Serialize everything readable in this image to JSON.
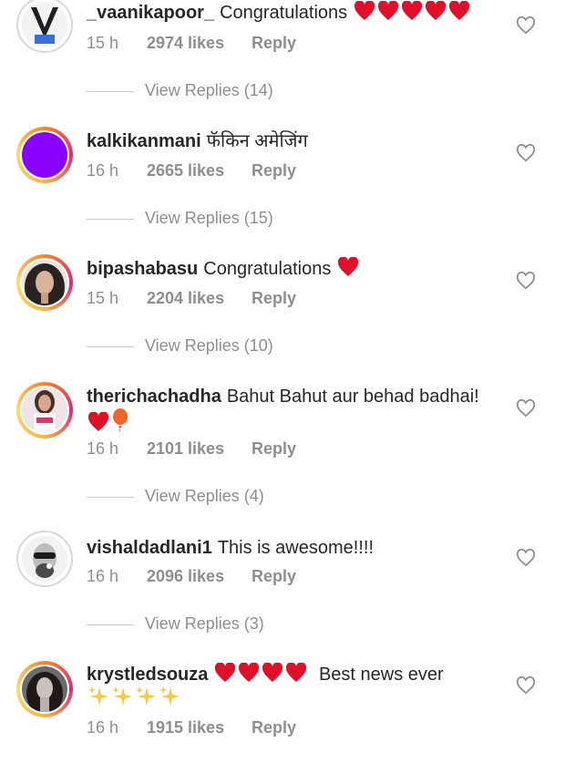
{
  "comments": [
    {
      "username": "_vaanikapoor_",
      "text": "Congratulations",
      "emoji": [
        "red-heart",
        "red-heart",
        "red-heart",
        "red-heart",
        "red-heart"
      ],
      "time": "15 h",
      "likes": "2974 likes",
      "reply": "Reply",
      "view_replies": "View Replies (14)"
    },
    {
      "username": "kalkikanmani",
      "text": "फॅकिन अमेजिंग",
      "time": "16 h",
      "likes": "2665 likes",
      "reply": "Reply",
      "view_replies": "View Replies (15)"
    },
    {
      "username": "bipashabasu",
      "text": "Congratulations",
      "emoji": [
        "red-heart"
      ],
      "time": "15 h",
      "likes": "2204 likes",
      "reply": "Reply",
      "view_replies": "View Replies (10)"
    },
    {
      "username": "therichachadha",
      "text": "Bahut Bahut aur behad badhai!",
      "emoji": [
        "red-heart",
        "balloon"
      ],
      "time": "16 h",
      "likes": "2101 likes",
      "reply": "Reply",
      "view_replies": "View Replies (4)"
    },
    {
      "username": "vishaldadlani1",
      "text": "This is awesome!!!!",
      "time": "16 h",
      "likes": "2096 likes",
      "reply": "Reply",
      "view_replies": "View Replies (3)"
    },
    {
      "username": "krystledsouza",
      "text": "Best news ever",
      "emoji": [
        "red-heart",
        "red-heart",
        "red-heart",
        "red-heart",
        "sparkles",
        "sparkles",
        "sparkles",
        "sparkles"
      ],
      "time": "16 h",
      "likes": "1915 likes",
      "reply": "Reply"
    }
  ],
  "colors": {
    "heart": "#e0102b",
    "muted": "#8e8e8e",
    "text": "#262626"
  }
}
